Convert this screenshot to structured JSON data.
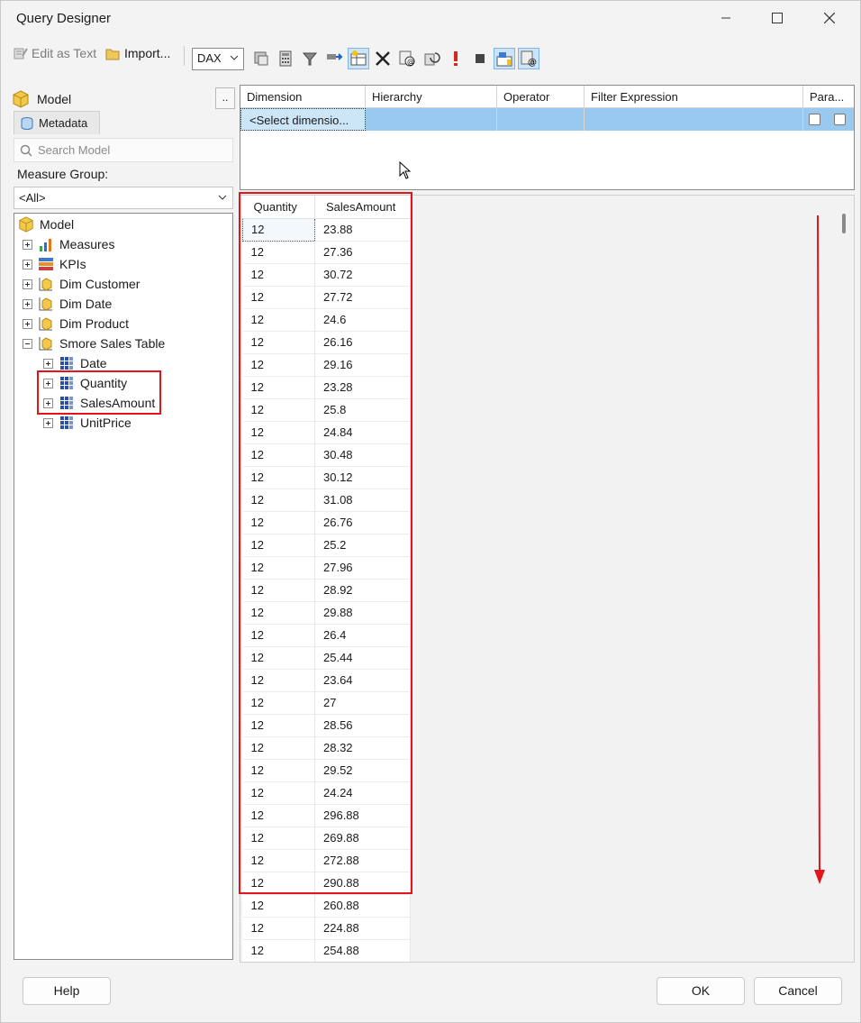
{
  "window": {
    "title": "Query Designer"
  },
  "toolbar": {
    "edit_as_text": "Edit as Text",
    "import": "Import...",
    "query_language": "DAX"
  },
  "left_pane": {
    "model_tab": "Model",
    "ellipsis": "..",
    "metadata_tab": "Metadata",
    "search_placeholder": "Search Model",
    "measure_group_label": "Measure Group:",
    "measure_group_value": "<All>",
    "tree": {
      "root": "Model",
      "items": [
        "Measures",
        "KPIs",
        "Dim Customer",
        "Dim Date",
        "Dim Product",
        "Smore Sales Table"
      ],
      "children": [
        "Date",
        "Quantity",
        "SalesAmount",
        "UnitPrice"
      ]
    }
  },
  "filter_grid": {
    "columns": [
      "Dimension",
      "Hierarchy",
      "Operator",
      "Filter Expression",
      "Para..."
    ],
    "row": {
      "dimension": "<Select dimensio..."
    }
  },
  "results": {
    "columns": [
      "Quantity",
      "SalesAmount"
    ],
    "rows": [
      [
        "12",
        "23.88"
      ],
      [
        "12",
        "27.36"
      ],
      [
        "12",
        "30.72"
      ],
      [
        "12",
        "27.72"
      ],
      [
        "12",
        "24.6"
      ],
      [
        "12",
        "26.16"
      ],
      [
        "12",
        "29.16"
      ],
      [
        "12",
        "23.28"
      ],
      [
        "12",
        "25.8"
      ],
      [
        "12",
        "24.84"
      ],
      [
        "12",
        "30.48"
      ],
      [
        "12",
        "30.12"
      ],
      [
        "12",
        "31.08"
      ],
      [
        "12",
        "26.76"
      ],
      [
        "12",
        "25.2"
      ],
      [
        "12",
        "27.96"
      ],
      [
        "12",
        "28.92"
      ],
      [
        "12",
        "29.88"
      ],
      [
        "12",
        "26.4"
      ],
      [
        "12",
        "25.44"
      ],
      [
        "12",
        "23.64"
      ],
      [
        "12",
        "27"
      ],
      [
        "12",
        "28.56"
      ],
      [
        "12",
        "28.32"
      ],
      [
        "12",
        "29.52"
      ],
      [
        "12",
        "24.24"
      ],
      [
        "12",
        "296.88"
      ],
      [
        "12",
        "269.88"
      ],
      [
        "12",
        "272.88"
      ],
      [
        "12",
        "290.88"
      ],
      [
        "12",
        "260.88"
      ],
      [
        "12",
        "224.88"
      ],
      [
        "12",
        "254.88"
      ]
    ]
  },
  "buttons": {
    "help": "Help",
    "ok": "OK",
    "cancel": "Cancel"
  },
  "colors": {
    "highlight": "#e3141c",
    "selection": "#99c9ef"
  }
}
